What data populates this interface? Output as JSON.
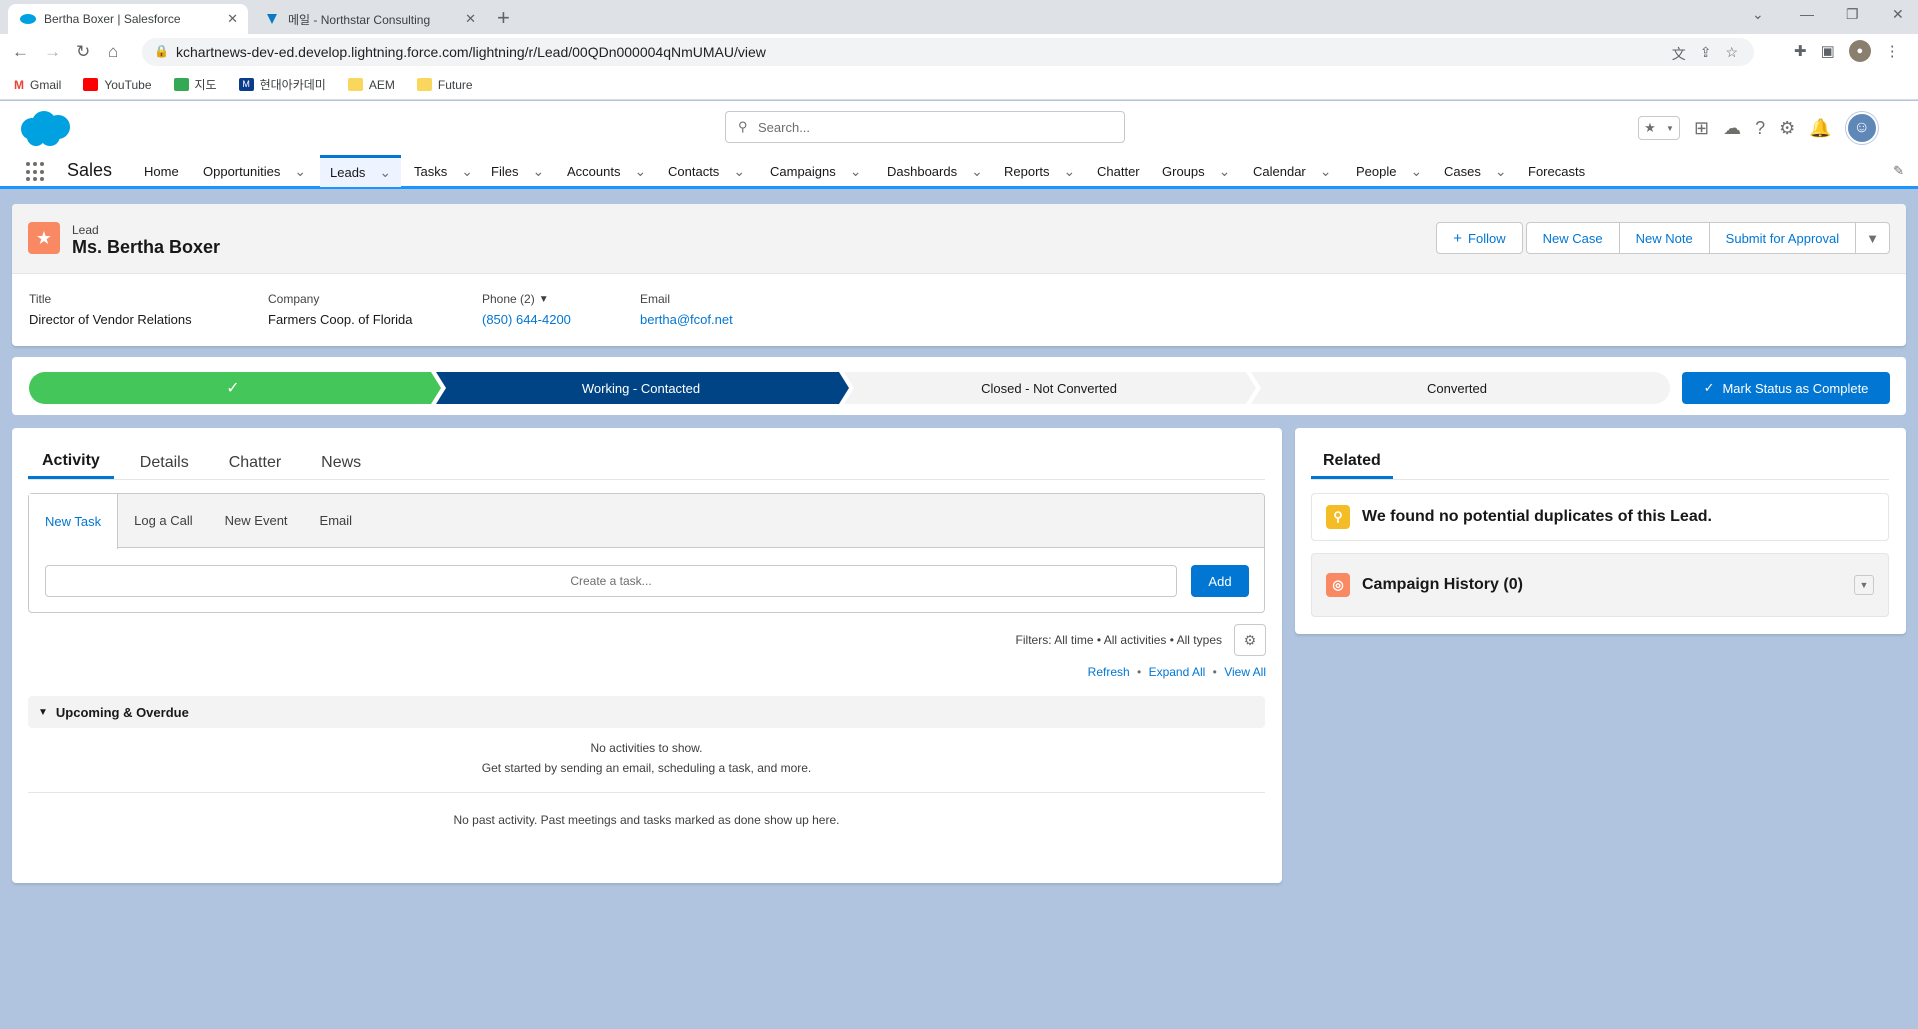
{
  "browser": {
    "tabs": [
      {
        "title": "Bertha Boxer | Salesforce",
        "active": true
      },
      {
        "title": "메일 - Northstar Consulting",
        "active": false
      }
    ],
    "new_tab": "+",
    "url": "kchartnews-dev-ed.develop.lightning.force.com/lightning/r/Lead/00QDn000004qNmUMAU/view",
    "bookmarks": [
      "Gmail",
      "YouTube",
      "지도",
      "현대아카데미",
      "AEM",
      "Future"
    ]
  },
  "header": {
    "search_placeholder": "Search...",
    "app_name": "Sales"
  },
  "nav": {
    "items": [
      {
        "label": "Home",
        "chevron": false
      },
      {
        "label": "Opportunities",
        "chevron": true
      },
      {
        "label": "Leads",
        "chevron": true,
        "active": true
      },
      {
        "label": "Tasks",
        "chevron": true
      },
      {
        "label": "Files",
        "chevron": true
      },
      {
        "label": "Accounts",
        "chevron": true
      },
      {
        "label": "Contacts",
        "chevron": true
      },
      {
        "label": "Campaigns",
        "chevron": true
      },
      {
        "label": "Dashboards",
        "chevron": true
      },
      {
        "label": "Reports",
        "chevron": true
      },
      {
        "label": "Chatter",
        "chevron": false
      },
      {
        "label": "Groups",
        "chevron": true
      },
      {
        "label": "Calendar",
        "chevron": true
      },
      {
        "label": "People",
        "chevron": true
      },
      {
        "label": "Cases",
        "chevron": true
      },
      {
        "label": "Forecasts",
        "chevron": false
      }
    ]
  },
  "record": {
    "object_type": "Lead",
    "name": "Ms. Bertha Boxer",
    "actions": {
      "follow": "Follow",
      "new_case": "New Case",
      "new_note": "New Note",
      "submit": "Submit for Approval"
    },
    "fields": {
      "title_label": "Title",
      "title_value": "Director of Vendor Relations",
      "company_label": "Company",
      "company_value": "Farmers Coop. of Florida",
      "phone_label": "Phone (2)",
      "phone_value": "(850) 644-4200",
      "email_label": "Email",
      "email_value": "bertha@fcof.net"
    }
  },
  "path": {
    "stages": [
      "",
      "Working - Contacted",
      "Closed - Not Converted",
      "Converted"
    ],
    "mark_button": "Mark Status as Complete"
  },
  "activity": {
    "tabs": [
      "Activity",
      "Details",
      "Chatter",
      "News"
    ],
    "composer_tabs": [
      "New Task",
      "Log a Call",
      "New Event",
      "Email"
    ],
    "task_placeholder": "Create a task...",
    "add_label": "Add",
    "filters": "Filters: All time • All activities • All types",
    "links": {
      "refresh": "Refresh",
      "expand": "Expand All",
      "view": "View All"
    },
    "upcoming_label": "Upcoming & Overdue",
    "empty_line1": "No activities to show.",
    "empty_line2": "Get started by sending an email, scheduling a task, and more.",
    "past_activity": "No past activity. Past meetings and tasks marked as done show up here."
  },
  "related": {
    "tab_label": "Related",
    "duplicates": "We found no potential duplicates of this Lead.",
    "campaign_history": "Campaign History (0)"
  },
  "colors": {
    "brand": "#0176d3",
    "path_complete": "#45c65a",
    "path_current": "#014486",
    "lead_icon": "#f88962",
    "background": "#b0c4df"
  }
}
